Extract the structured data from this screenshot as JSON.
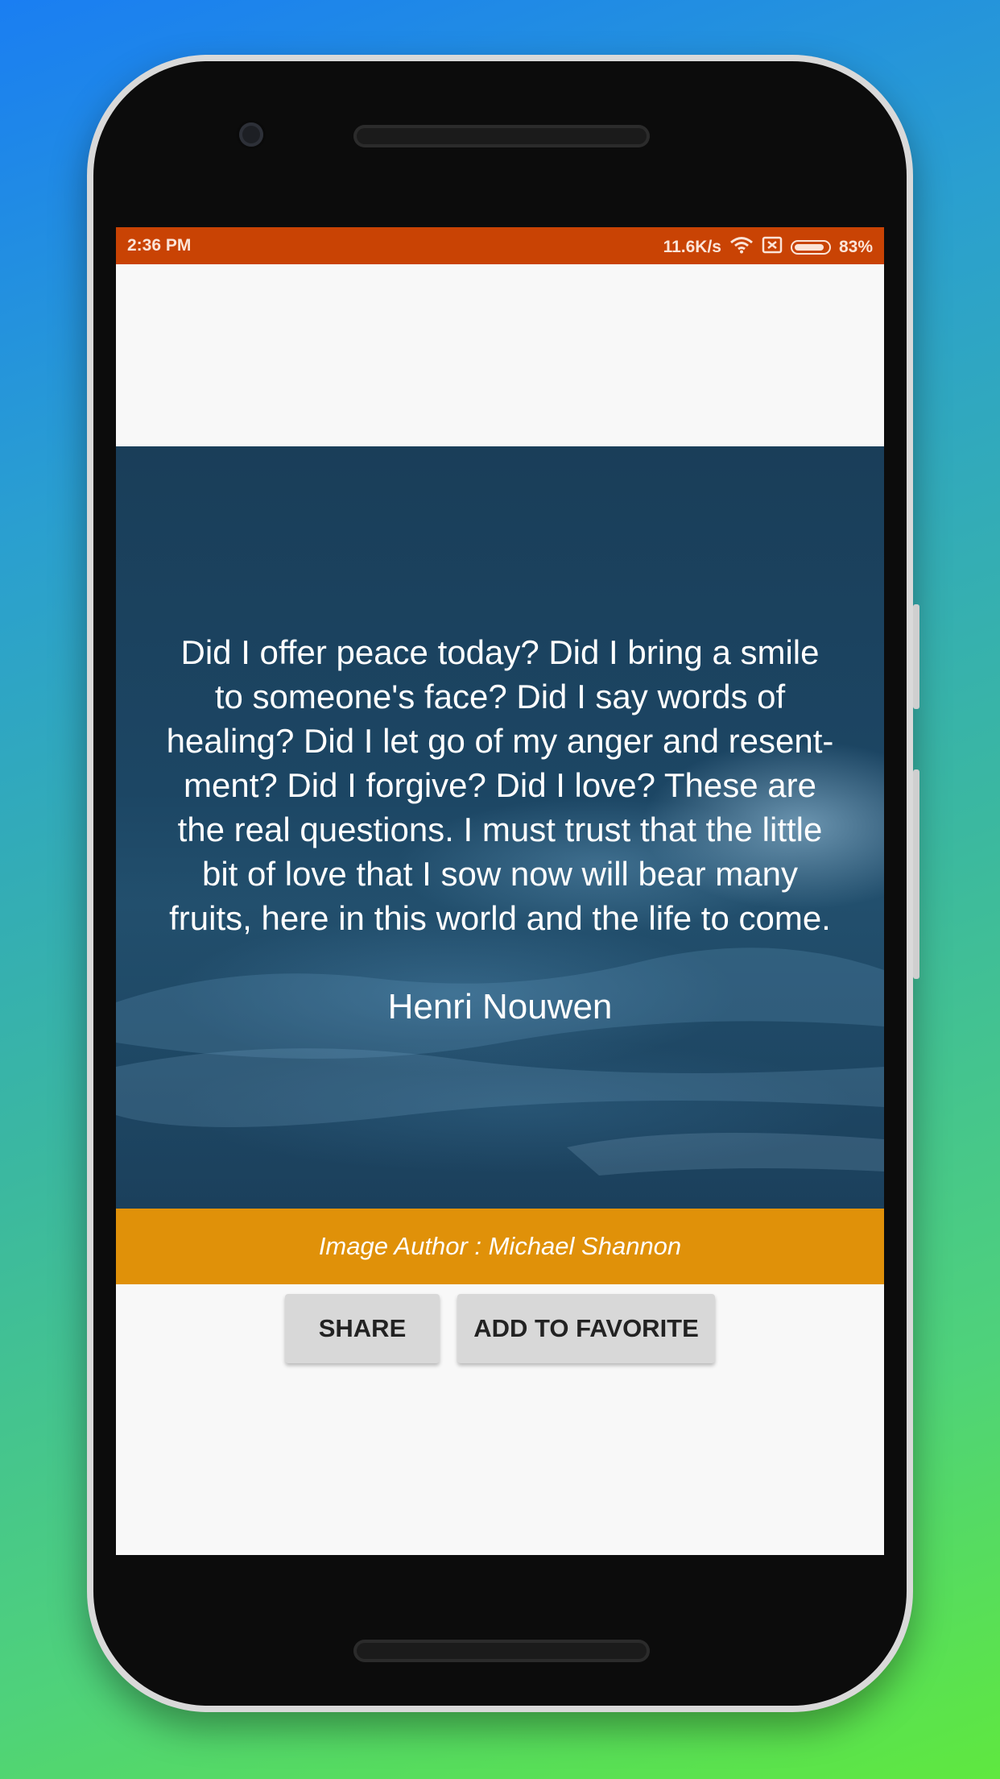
{
  "status_bar": {
    "time": "2:36 PM",
    "network_speed": "11.6K/s",
    "battery_percent": "83%",
    "icons": [
      "wifi-icon",
      "sim-off-icon",
      "battery-icon"
    ]
  },
  "quote": {
    "lines": [
      "Did I offer peace today? Did I bring a smile",
      "to someone's face? Did I say words of",
      "healing? Did I let go of my anger and resent-",
      "ment? Did I forgive? Did I love? These are",
      "the real questions. I must trust that the little",
      "bit of love that I sow now will bear many",
      "fruits, here in this world and the life to come."
    ],
    "author": "Henri Nouwen"
  },
  "image_credit": "Image Author : Michael Shannon",
  "actions": {
    "share_label": "SHARE",
    "favorite_label": "ADD TO FAVORITE"
  },
  "colors": {
    "status_bar": "#c94304",
    "credit_bar": "#e09109",
    "quote_background": "#1b3f5b"
  }
}
